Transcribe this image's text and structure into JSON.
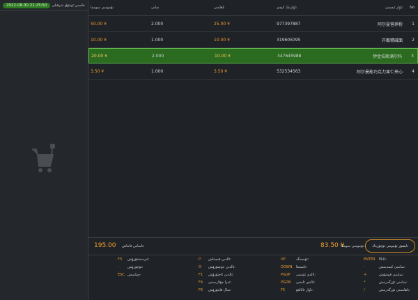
{
  "sidebar": {
    "datetime": "2022-08-30  21:25:50",
    "customer_label": "خاسىي ئوتتۇق شرقىلى"
  },
  "table": {
    "headers": {
      "amount": "تۇمومىي سومما",
      "qty": "سانى",
      "price": "باھاسى",
      "code": "تاۋارنىڭ كودى",
      "name": "تاۋار ئىسمى",
      "no": "No"
    },
    "rows": [
      {
        "amount": "50.00 ¥",
        "qty": "2.000",
        "price": "25.00 ¥",
        "code": "977397887",
        "name": "阿尔曼营养粉",
        "no": "1",
        "active": false
      },
      {
        "amount": "10.00 ¥",
        "qty": "1.000",
        "price": "10.00 ¥",
        "code": "319605095",
        "name": "开都精碱面",
        "no": "2",
        "active": false
      },
      {
        "amount": "20.00 ¥",
        "qty": "2.000",
        "price": "10.00 ¥",
        "code": "347645988",
        "name": "伊金拉斯满尔玛",
        "no": "3",
        "active": true
      },
      {
        "amount": "3.50 ¥",
        "qty": "1.000",
        "price": "3.50 ¥",
        "code": "532534563",
        "name": "阿尔曼能巧克力果仁夹心",
        "no": "4",
        "active": false
      }
    ]
  },
  "summary": {
    "total_value": "195.00",
    "total_label": "ئاساس قاتناش:",
    "paid_value": "83.50 ¥",
    "paid_label": "تۇمومىي سومما:",
    "pay_button": "تاپشۇر تۇمومى ئۆچۈرەڭ"
  },
  "shortcuts": [
    {
      "key": "ENTER",
      "desc": "PLU:"
    },
    {
      "key": "-",
      "desc": "سانىنى كېمەيتىش:"
    },
    {
      "key": "+",
      "desc": "سانىنى قوشۇش:"
    },
    {
      "key": "*",
      "desc": "سانىنى ئۆزگەرتىش:"
    },
    {
      "key": "/",
      "desc": "باھاسىنى ئۆزگەرتىش:"
    },
    {
      "key": "UP",
      "desc": "ئۈستىگە:"
    },
    {
      "key": "DOWN",
      "desc": "ئاستىغا:"
    },
    {
      "key": "PGUP",
      "desc": "ئالدى ئۆستى:"
    },
    {
      "key": "PGDN",
      "desc": "ئالدى ئاستى:"
    },
    {
      "key": "F5",
      "desc": "تاۋار ئاتالغۇ:"
    },
    {
      "key": "P",
      "desc": "ئالدىن قىستاش:"
    },
    {
      "key": "O",
      "desc": "ئالدىن چوشۇرۇش:"
    },
    {
      "key": "F1",
      "desc": "ئالدىن ئاختۇرۇش:"
    },
    {
      "key": "F4",
      "desc": "ئەزا مۇلازىمىتى:"
    },
    {
      "key": "F6",
      "desc": "سال قايتۇرۇش:"
    },
    {
      "key": "F3",
      "desc": "ئىزدەشتۇرۇش:"
    },
    {
      "key": "-",
      "desc": "ئۆچۈرۈش:"
    },
    {
      "key": "ESC",
      "desc": "چېكىنىش:"
    }
  ]
}
